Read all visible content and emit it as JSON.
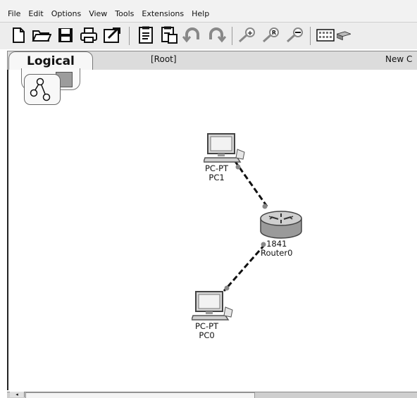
{
  "menubar": {
    "items": [
      "File",
      "Edit",
      "Options",
      "View",
      "Tools",
      "Extensions",
      "Help"
    ]
  },
  "toolbar": {
    "icons": [
      "new-file-icon",
      "open-folder-icon",
      "save-icon",
      "print-icon",
      "activity-wizard-icon",
      "copy-icon",
      "paste-icon",
      "undo-icon",
      "redo-icon",
      "zoom-in-icon",
      "zoom-reset-icon",
      "zoom-out-icon",
      "palette-icon",
      "custom-device-icon"
    ]
  },
  "workspace": {
    "tab_label": "Logical",
    "path": "[Root]",
    "new_cluster_label": "New C"
  },
  "devices": [
    {
      "name": "PC1",
      "model": "PC-PT",
      "type": "pc"
    },
    {
      "name": "Router0",
      "model": "1841",
      "type": "router"
    },
    {
      "name": "PC0",
      "model": "PC-PT",
      "type": "pc"
    }
  ],
  "links": [
    {
      "from": "PC1",
      "to": "Router0",
      "style": "dashed",
      "color": "#111111"
    },
    {
      "from": "Router0",
      "to": "PC0",
      "style": "dashed",
      "color": "#111111"
    }
  ]
}
